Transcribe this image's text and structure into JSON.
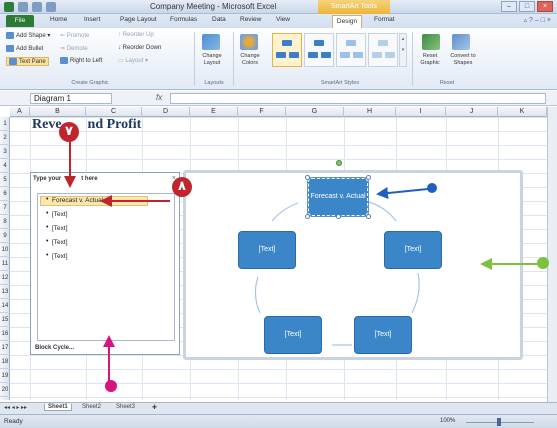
{
  "window": {
    "title": "Company Meeting - Microsoft Excel",
    "contextual_tab_group": "SmartArt Tools"
  },
  "tabs": [
    "File",
    "Home",
    "Insert",
    "Page Layout",
    "Formulas",
    "Data",
    "Review",
    "View",
    "Design",
    "Format"
  ],
  "ribbon": {
    "create_graphic": {
      "add_shape": "Add Shape",
      "add_bullet": "Add Bullet",
      "text_pane": "Text Pane",
      "promote": "Promote",
      "demote": "Demote",
      "right_to_left": "Right to Left",
      "reorder_up": "Reorder Up",
      "reorder_down": "Reorder Down",
      "layout": "Layout",
      "label": "Create Graphic"
    },
    "layouts": {
      "change_layout": "Change Layout",
      "label": "Layouts"
    },
    "smartart_styles": {
      "change_colors": "Change Colors",
      "label": "SmartArt Styles"
    },
    "reset": {
      "reset_graphic": "Reset Graphic",
      "convert": "Convert to Shapes",
      "label": "Reset"
    }
  },
  "formula_bar": {
    "name_box": "Diagram 1",
    "fx": "fx",
    "value": ""
  },
  "columns": [
    "A",
    "B",
    "C",
    "D",
    "E",
    "F",
    "G",
    "H",
    "I",
    "J",
    "K"
  ],
  "rows": [
    "1",
    "2",
    "3",
    "4",
    "5",
    "6",
    "7",
    "8",
    "9",
    "10",
    "11",
    "12",
    "13",
    "14",
    "15",
    "16",
    "17",
    "18",
    "19",
    "20"
  ],
  "sheet": {
    "title": "Revenue and Profit",
    "title_visible_prefix": "Reve",
    "title_visible_suffix": "nd Profit"
  },
  "text_pane": {
    "heading": "Type your text here",
    "heading_visible_prefix": "Type your",
    "heading_visible_suffix": "t here",
    "items": [
      "Forecast v. Actual",
      "[Text]",
      "[Text]",
      "[Text]",
      "[Text]"
    ],
    "footer": "Block Cycle..."
  },
  "smartart": {
    "nodes": [
      "Forecast v. Actual",
      "[Text]",
      "[Text]",
      "[Text]",
      "[Text]"
    ],
    "color": "#3a86c8"
  },
  "sheet_tabs": [
    "Sheet1",
    "Sheet2",
    "Sheet3"
  ],
  "status": {
    "mode": "Ready",
    "zoom": "100%"
  },
  "callouts": {
    "seven": "٧",
    "eight": "٨"
  },
  "annotation_colors": {
    "red": "#c0252d",
    "blue": "#1f5fbf",
    "green": "#7dc13c",
    "magenta": "#d6157e"
  }
}
